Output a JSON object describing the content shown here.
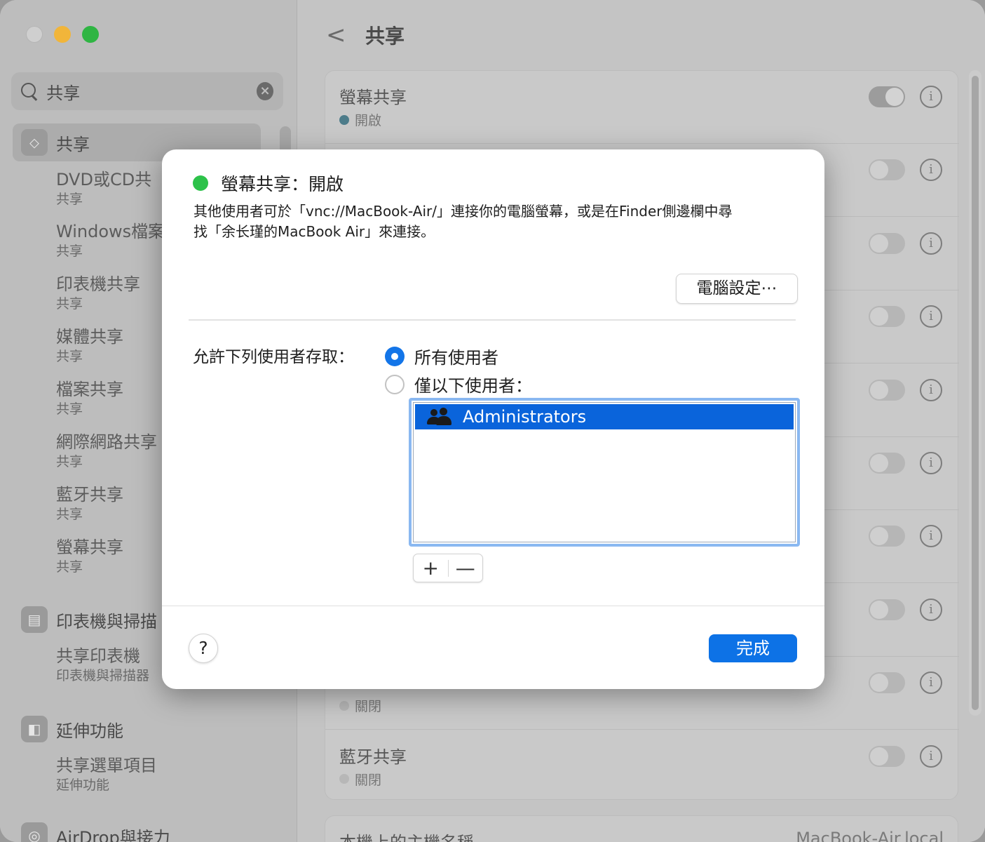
{
  "sidebar": {
    "search": {
      "value": "共享"
    },
    "items": [
      {
        "label": "共享",
        "icon": "sharing-icon"
      },
      {
        "title": "DVD或CD共",
        "sub": "共享"
      },
      {
        "title": "Windows檔案",
        "sub": "共享"
      },
      {
        "title": "印表機共享",
        "sub": "共享"
      },
      {
        "title": "媒體共享",
        "sub": "共享"
      },
      {
        "title": "檔案共享",
        "sub": "共享"
      },
      {
        "title": "網際網路共享",
        "sub": "共享"
      },
      {
        "title": "藍牙共享",
        "sub": "共享"
      },
      {
        "title": "螢幕共享",
        "sub": "共享"
      }
    ],
    "printers": {
      "label": "印表機與掃描",
      "icon": "printer-icon",
      "sub_title": "共享印表機",
      "sub_sub": "印表機與掃描器"
    },
    "extensions": {
      "label": "延伸功能",
      "icon": "extensions-icon",
      "sub_title": "共享選單項目",
      "sub_sub": "延伸功能"
    },
    "airdrop": {
      "label": "AirDrop與接力",
      "icon": "airdrop-icon"
    }
  },
  "main": {
    "back": "<",
    "title": "共享",
    "rows": [
      {
        "title": "螢幕共享",
        "status": "開啟",
        "on": true
      },
      {
        "title": "",
        "status": "",
        "on": false
      },
      {
        "title": "",
        "status": "",
        "on": false
      },
      {
        "title": "",
        "status": "",
        "on": false
      },
      {
        "title": "",
        "status": "",
        "on": false
      },
      {
        "title": "",
        "status": "",
        "on": false
      },
      {
        "title": "",
        "status": "",
        "on": false
      },
      {
        "title": "",
        "status": "",
        "on": false
      },
      {
        "title": "",
        "status": "關閉",
        "on": false
      },
      {
        "title": "藍牙共享",
        "status": "關閉",
        "on": false
      }
    ],
    "hostname_label": "本機上的主機名稱",
    "hostname_value": "MacBook-Air.local"
  },
  "dialog": {
    "title": "螢幕共享：開啟",
    "status_color": "#2dc24a",
    "desc_line1": "其他使用者可於「vnc://MacBook-Air/」連接你的電腦螢幕，或是在Finder側邊欄中尋",
    "desc_line2": "找「余长瑾的MacBook Air」來連接。",
    "settings_button": "電腦設定⋯",
    "allow_label": "允許下列使用者存取：",
    "radio_all": "所有使用者",
    "radio_only": "僅以下使用者：",
    "list_items": [
      "Administrators"
    ],
    "plus": "+",
    "minus": "—",
    "help": "?",
    "done": "完成",
    "accent": "#0d72e6"
  }
}
